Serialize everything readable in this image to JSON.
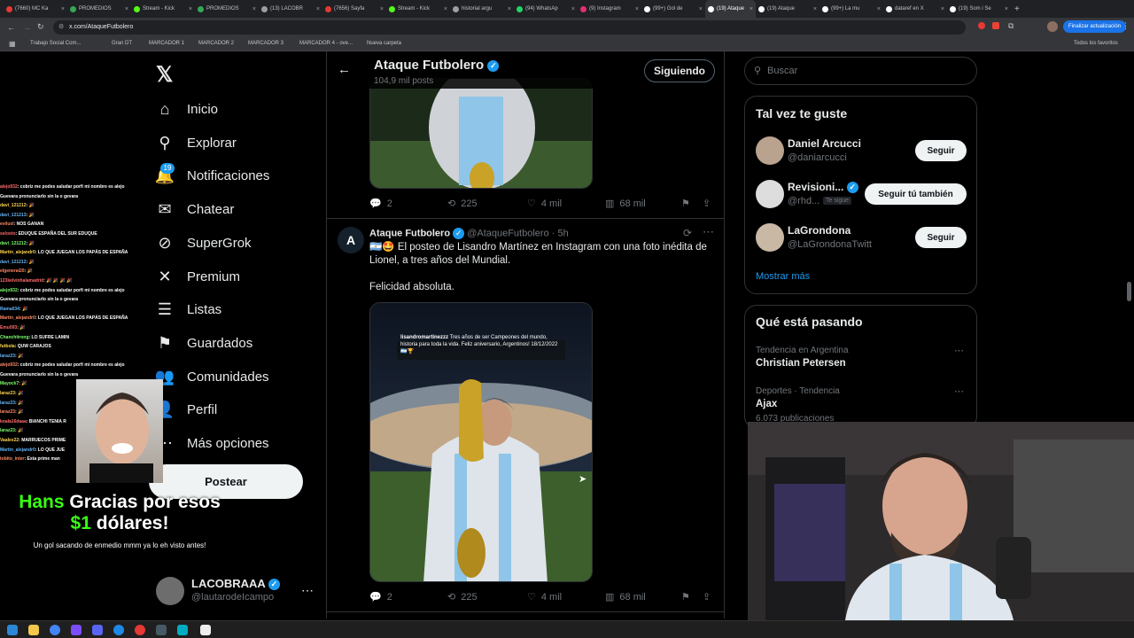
{
  "browser": {
    "tabs": [
      {
        "label": "(7660) MC Ka",
        "color": "#e53935"
      },
      {
        "label": "PROMEDIOS",
        "color": "#34a853"
      },
      {
        "label": "Stream - Kick",
        "color": "#53fc18"
      },
      {
        "label": "PROMEDIOS",
        "color": "#34a853"
      },
      {
        "label": "(13) LACOBR",
        "color": "#9e9e9e"
      },
      {
        "label": "(7656) Sayfa",
        "color": "#e53935"
      },
      {
        "label": "Stream - Kick",
        "color": "#53fc18"
      },
      {
        "label": "historial argu",
        "color": "#9aa0a6"
      },
      {
        "label": "(94) WhatsAp",
        "color": "#25d366"
      },
      {
        "label": "(9) Instagram",
        "color": "#e1306c"
      },
      {
        "label": "(99+) Gol de",
        "color": "#ffffff"
      },
      {
        "label": "(19) Ataque",
        "color": "#ffffff"
      },
      {
        "label": "(19) Ataque",
        "color": "#ffffff"
      },
      {
        "label": "(99+) La mu",
        "color": "#ffffff"
      },
      {
        "label": "dataref en X",
        "color": "#ffffff"
      },
      {
        "label": "(19) Som i Se",
        "color": "#ffffff"
      }
    ],
    "url": "x.com/AtaqueFutbolero",
    "update_button": "Finalizar actualización",
    "bookmarks": [
      "Trabajo Social Com...",
      "Gran DT",
      "MARCADOR 1",
      "MARCADOR 2",
      "MARCADOR 3",
      "MARCADOR 4 - ove...",
      "Nueva carpeta"
    ],
    "all_bookmarks": "Todos los favoritos"
  },
  "nav": {
    "items": [
      {
        "label": "Inicio",
        "icon": "home-icon",
        "glyph": "⌂"
      },
      {
        "label": "Explorar",
        "icon": "search-icon",
        "glyph": "⚲"
      },
      {
        "label": "Notificaciones",
        "icon": "bell-icon",
        "glyph": "🔔"
      },
      {
        "label": "Chatear",
        "icon": "mail-icon",
        "glyph": "✉"
      },
      {
        "label": "SuperGrok",
        "icon": "grok-icon",
        "glyph": "⊘"
      },
      {
        "label": "Premium",
        "icon": "x-logo-icon",
        "glyph": "✕"
      },
      {
        "label": "Listas",
        "icon": "list-icon",
        "glyph": "☰"
      },
      {
        "label": "Guardados",
        "icon": "bookmark-icon",
        "glyph": "⚑"
      },
      {
        "label": "Comunidades",
        "icon": "people-icon",
        "glyph": "👥"
      },
      {
        "label": "Perfil",
        "icon": "person-icon",
        "glyph": "👤"
      },
      {
        "label": "Más opciones",
        "icon": "more-circle-icon",
        "glyph": "⋯"
      }
    ],
    "notif_badge": "19",
    "post_label": "Postear",
    "account_name": "LACOBRAAA",
    "account_handle": "@lautarodeIcampo"
  },
  "overlay": {
    "donor": "Hans",
    "thanks": "Gracias por esos",
    "amount": "$1",
    "currency": "dólares!",
    "caption": "Un gol sacando de enmedio mmm ya lo eh visto antes!"
  },
  "chat": [
    {
      "user": "alejo932",
      "msg": ": cobriz me podes saludar porfi mi nombre es alejo"
    },
    {
      "user": "",
      "msg": "Guevara pronunciarlo sin la o gevara"
    },
    {
      "user": "davi_121212",
      "msg": ": 🎉"
    },
    {
      "user": "davi_121213",
      "msg": ": 🎉"
    },
    {
      "user": "eviluxl",
      "msg": ": NOS GANAN"
    },
    {
      "user": "seloxto",
      "msg": ": EDUQUE ESPAÑA DEL SUR EDUQUE"
    },
    {
      "user": "davi_121212",
      "msg": ": 🎉"
    },
    {
      "user": "Martin_alejandr0",
      "msg": ": LO QUE JUEGAN LOS PAPÁS DE ESPAÑA"
    },
    {
      "user": "davi_121212",
      "msg": ": 🎉"
    },
    {
      "user": "elgeneral20",
      "msg": ": 🎉"
    },
    {
      "user": "123kelvinhalamadrid",
      "msg": ": 🎉 🎉 🎉 🎉"
    },
    {
      "user": "alejo932",
      "msg": ": cobriz me podes saludar porfi mi nombre es alejo"
    },
    {
      "user": "",
      "msg": "Guevara pronunciarlo sin la o gevara"
    },
    {
      "user": "Rama034",
      "msg": ": 🎉"
    },
    {
      "user": "Martin_alejandr0",
      "msg": ": LO QUE JUEGAN LOS PAPÁS DE ESPAÑA"
    },
    {
      "user": "Emu093",
      "msg": ": 🎉"
    },
    {
      "user": "Chanchitrong",
      "msg": ": LO SUFRE LAMIN"
    },
    {
      "user": "futbola",
      "msg": ": QUW CARAJOS"
    },
    {
      "user": "laraz23",
      "msg": ": 🎉"
    },
    {
      "user": "alejo932",
      "msg": ": cobriz me podes saludar porfi mi nombre es alejo"
    },
    {
      "user": "",
      "msg": "Guevara pronunciarlo sin la o gevara"
    },
    {
      "user": "Mayock7",
      "msg": ": 🎉"
    },
    {
      "user": "laraz23",
      "msg": ": 🎉"
    },
    {
      "user": "laraz23",
      "msg": ": 🎉"
    },
    {
      "user": "laraz23",
      "msg": ": 🎉"
    },
    {
      "user": "koala16daaa",
      "msg": ": BIANCHI TENIA R"
    },
    {
      "user": "laraz23",
      "msg": ": 🎉"
    },
    {
      "user": "Vaalex22",
      "msg": ": MARRUECOS PRIME"
    },
    {
      "user": "Martin_alejandr0",
      "msg": ": LO QUE JUE"
    },
    {
      "user": "tobito_inter",
      "msg": ": Esta prime man"
    }
  ],
  "header": {
    "title": "Ataque Futbolero",
    "posts": "104,9 mil posts",
    "following": "Siguiendo"
  },
  "tweet1": {
    "replies": "2",
    "retweets": "225",
    "likes": "4 mil",
    "views": "68 mil"
  },
  "tweet2": {
    "name": "Ataque Futbolero",
    "handle": "@AtaqueFutbolero",
    "time": "· 5h",
    "text": "🇦🇷🤩 El posteo de Lisandro Martínez en Instagram con una foto inédita de Lionel, a tres años del Mundial.",
    "text2": "Felicidad absoluta.",
    "media_caption_user": "lisandromartinezzz",
    "media_caption": "Tres años de ser Campeones del mundo, historia para toda la vida. Feliz aniversario, Argentinos! 18/12/2022 🇦🇷🏆",
    "replies": "2",
    "retweets": "225",
    "likes": "4 mil",
    "views": "68 mil"
  },
  "right": {
    "search_placeholder": "Buscar",
    "suggest_title": "Tal vez te guste",
    "suggestions": [
      {
        "name": "Daniel Arcucci",
        "handle": "@daniarcucci",
        "button": "Seguir",
        "follows_you": ""
      },
      {
        "name": "Revisioni...",
        "handle": "@rhd...",
        "button": "Seguir tú también",
        "follows_you": "Te sigue"
      },
      {
        "name": "LaGrondona",
        "handle": "@LaGrondonaTwitt",
        "button": "Seguir",
        "follows_you": ""
      }
    ],
    "show_more": "Mostrar más",
    "trends_title": "Qué está pasando",
    "trends": [
      {
        "context": "Tendencia en Argentina",
        "name": "Christian Petersen",
        "count": ""
      },
      {
        "context": "Deportes · Tendencia",
        "name": "Ajax",
        "count": "6.073 publicaciones"
      }
    ]
  },
  "colors": {
    "accent": "#1d9bf0",
    "overlay_green": "#39ff14"
  }
}
